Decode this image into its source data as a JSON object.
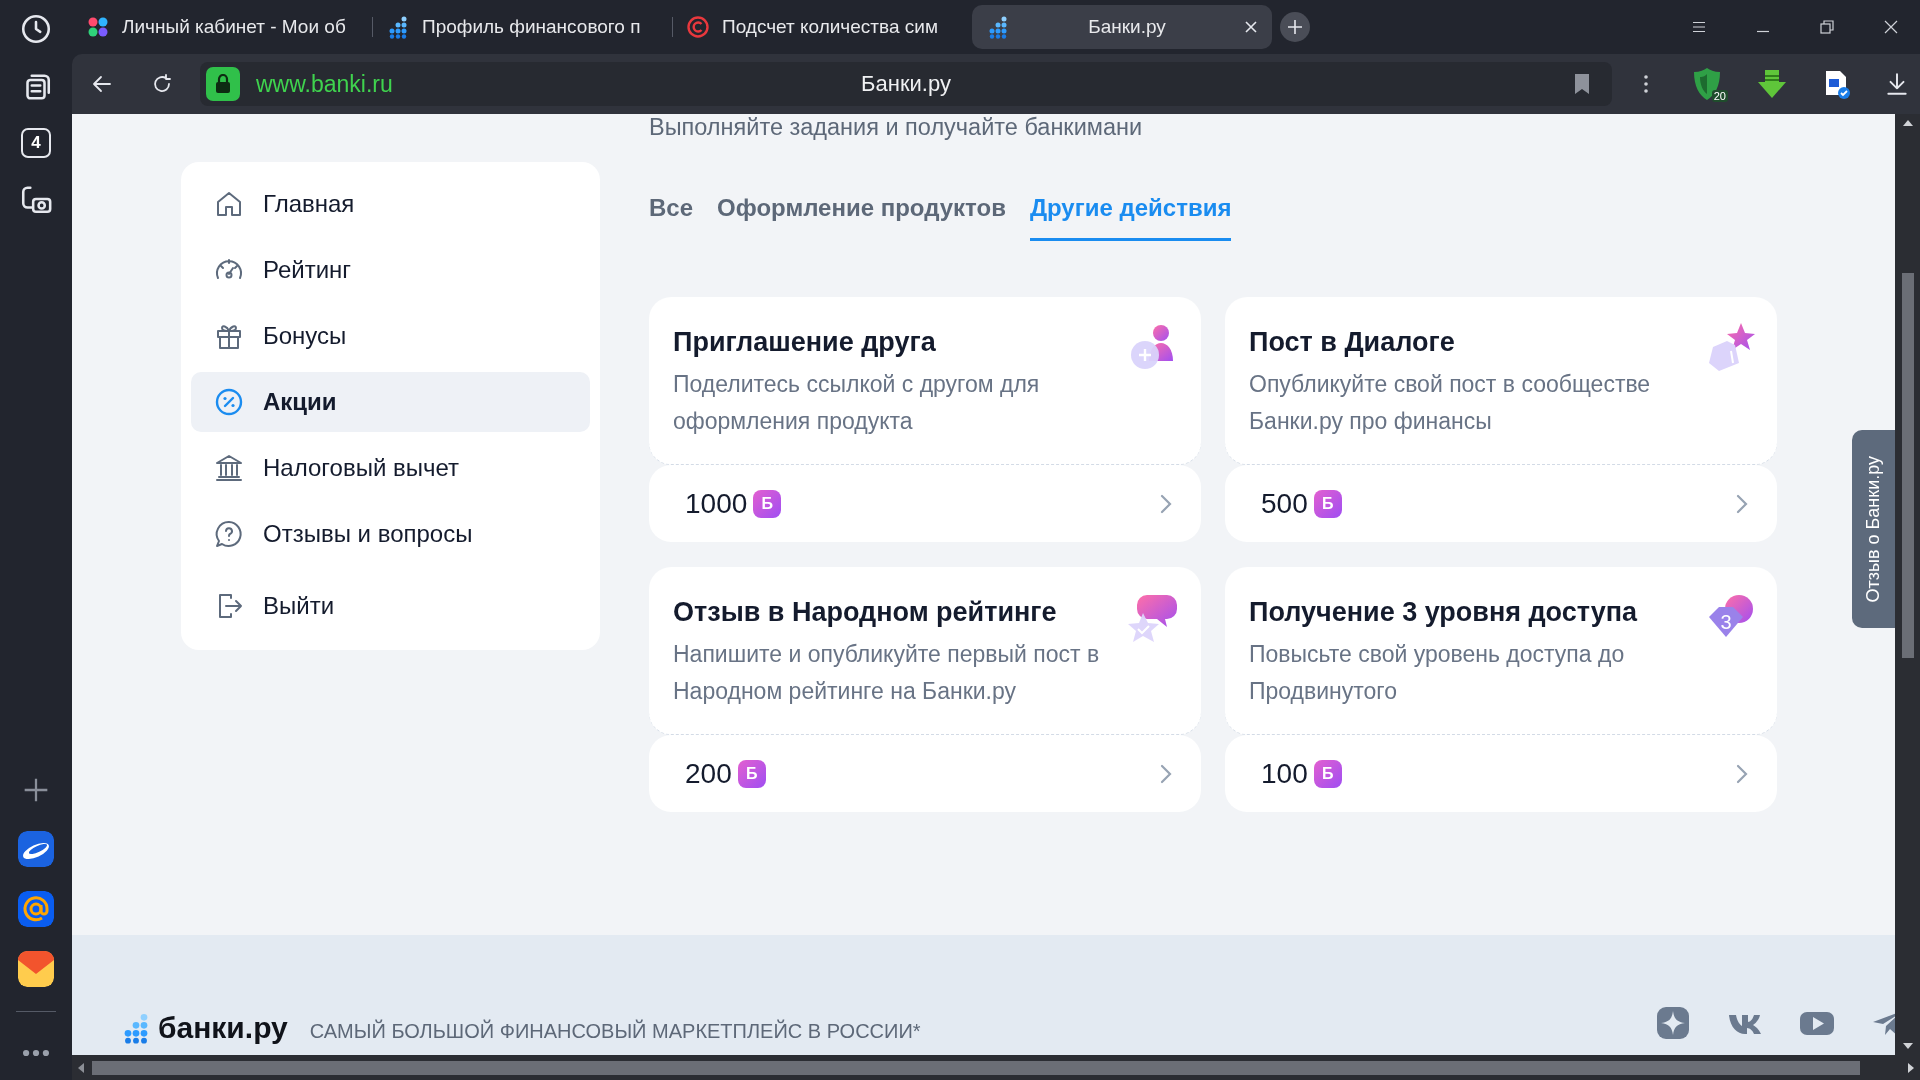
{
  "browser": {
    "tabs": [
      {
        "title": "Личный кабинет - Мои об",
        "kind": "dots",
        "selected": false
      },
      {
        "title": "Профиль финансового п",
        "kind": "banki",
        "selected": false
      },
      {
        "title": "Подсчет количества сим",
        "kind": "copyright",
        "selected": false
      },
      {
        "title": "Банки.ру",
        "kind": "banki",
        "selected": true
      }
    ],
    "address": {
      "url": "www.banki.ru",
      "title": "Банки.ру"
    },
    "shield_badge": "20",
    "side_counter": "4"
  },
  "page": {
    "subtitle": "Выполняйте задания и получайте банкимани",
    "menu": [
      {
        "label": "Главная",
        "kind": "home",
        "selected": false
      },
      {
        "label": "Рейтинг",
        "kind": "gauge",
        "selected": false
      },
      {
        "label": "Бонусы",
        "kind": "gift",
        "selected": false
      },
      {
        "label": "Акции",
        "kind": "percent",
        "selected": true
      },
      {
        "label": "Налоговый вычет",
        "kind": "bank",
        "selected": false
      },
      {
        "label": "Отзывы и вопросы",
        "kind": "question",
        "selected": false
      },
      {
        "label": "Выйти",
        "kind": "exit",
        "selected": false
      }
    ],
    "filter_tabs": [
      {
        "label": "Все",
        "selected": false
      },
      {
        "label": "Оформление продуктов",
        "selected": false
      },
      {
        "label": "Другие действия",
        "selected": true
      }
    ],
    "cards": [
      {
        "title": "Приглашение друга",
        "description": "Поделитесь ссылкой с другом для оформления продукта",
        "reward": "1000",
        "currency": "Б",
        "kind": "invite"
      },
      {
        "title": "Пост в Диалоге",
        "description": "Опубликуйте свой пост в сообществе Банки.ру про финансы",
        "reward": "500",
        "currency": "Б",
        "kind": "post"
      },
      {
        "title": "Отзыв в Народном рейтинге",
        "description": "Напишите и опубликуйте первый пост в Народном рейтинге на Банки.ру",
        "reward": "200",
        "currency": "Б",
        "kind": "review"
      },
      {
        "title": "Получение 3 уровня доступа",
        "description": "Повысьте свой уровень доступа до Продвинутого",
        "reward": "100",
        "currency": "Б",
        "kind": "level",
        "icon_text": "3"
      }
    ],
    "feedback_tab": "Отзыв о Банки.ру",
    "footer": {
      "logo": "банки.ру",
      "slogan": "САМЫЙ БОЛЬШОЙ ФИНАНСОВЫЙ МАРКЕТПЛЕЙС В РОССИИ*"
    }
  }
}
